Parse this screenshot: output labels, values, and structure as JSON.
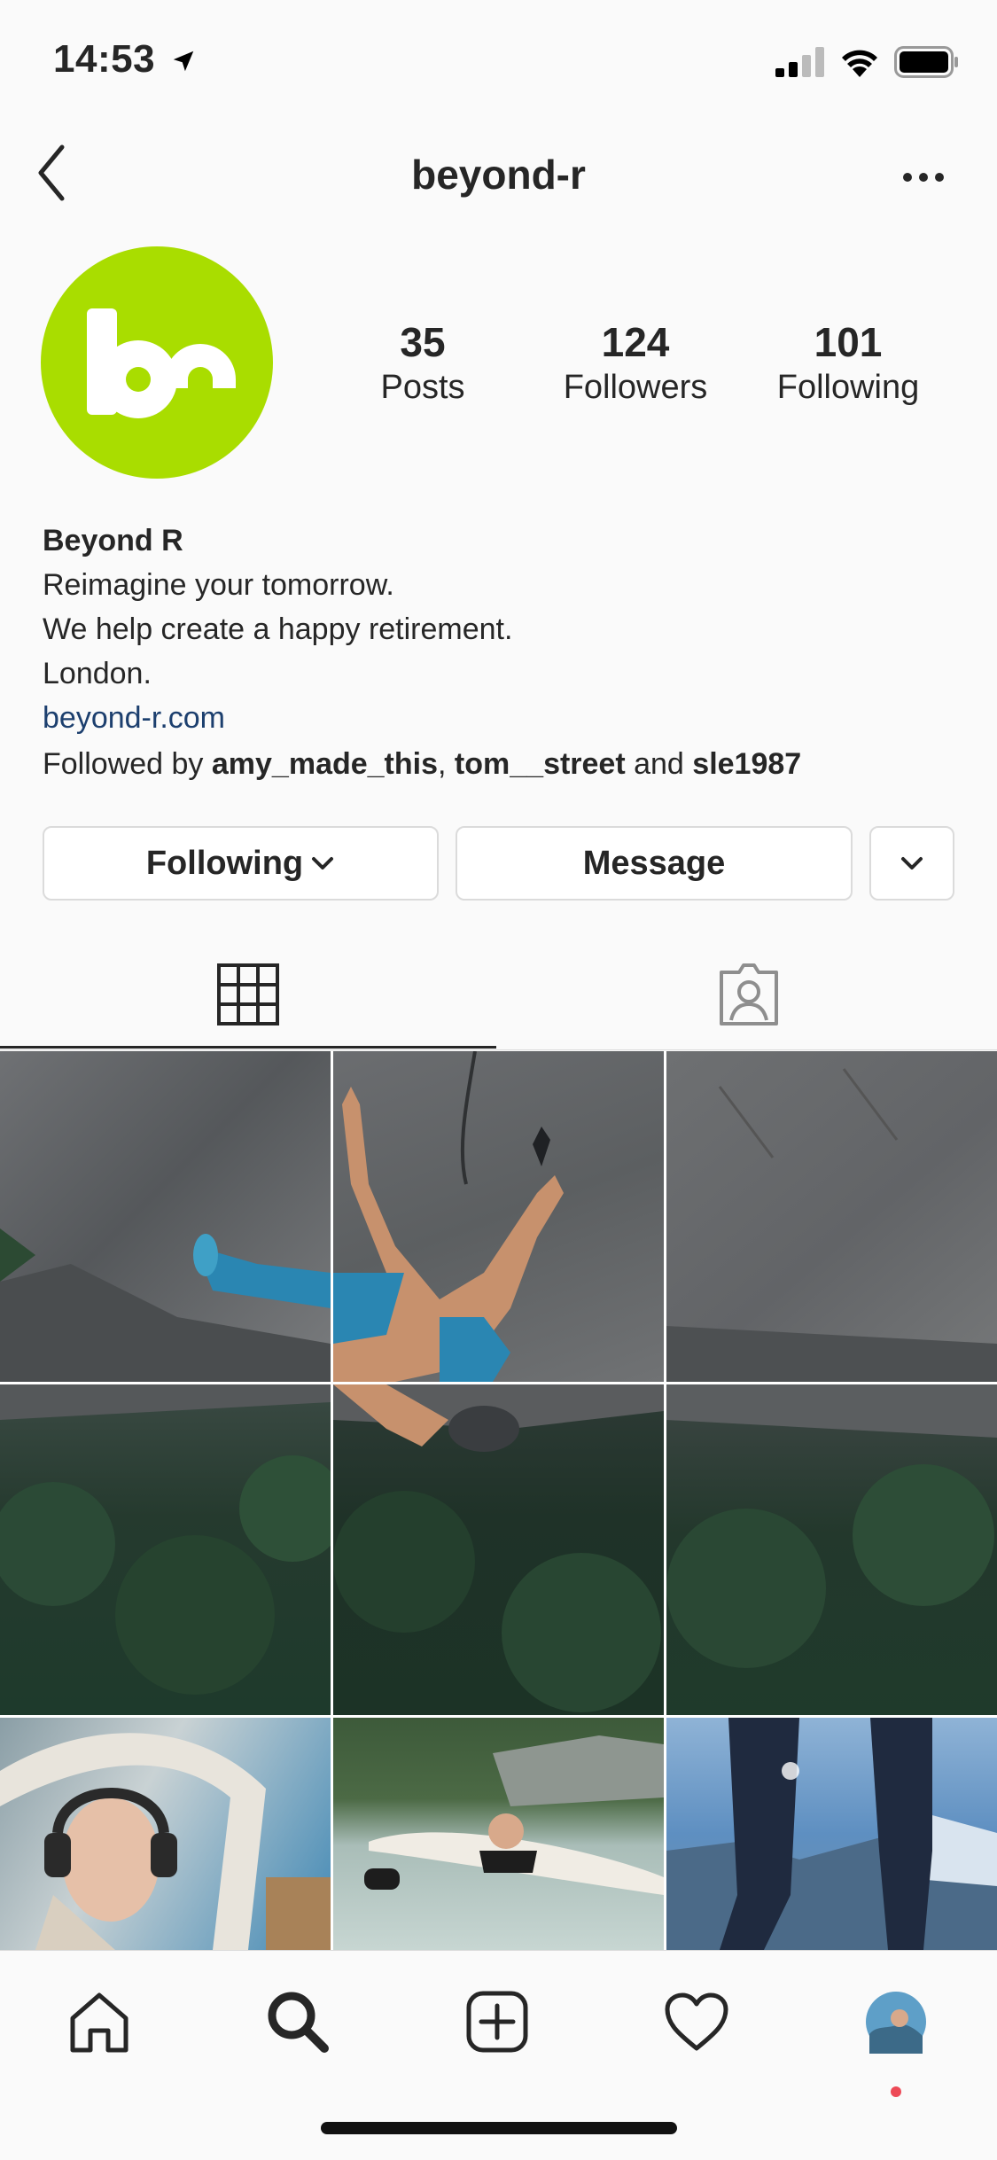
{
  "status_bar": {
    "time": "14:53"
  },
  "header": {
    "username": "beyond-r"
  },
  "profile": {
    "avatar_text": "br",
    "stats": [
      {
        "value": "35",
        "label": "Posts"
      },
      {
        "value": "124",
        "label": "Followers"
      },
      {
        "value": "101",
        "label": "Following"
      }
    ],
    "name": "Beyond R",
    "bio_lines": [
      "Reimagine your tomorrow.",
      "We help create a happy retirement.",
      "London."
    ],
    "link": "beyond-r.com",
    "followed_by": {
      "prefix": "Followed by ",
      "users": [
        "amy_made_this",
        "tom__street",
        "sle1987"
      ],
      "sep": ", ",
      "and": " and "
    }
  },
  "actions": {
    "following_label": "Following",
    "message_label": "Message"
  },
  "tabs": [
    {
      "name": "grid",
      "icon": "grid-icon",
      "active": true
    },
    {
      "name": "tagged",
      "icon": "tagged-person-icon",
      "active": false
    }
  ],
  "colors": {
    "brand": "#a9dd00",
    "link": "#1c3f6e",
    "notification_dot": "#ed4956"
  },
  "grid_posts": [
    {
      "icon": "photo-climber-rock-top-left"
    },
    {
      "icon": "photo-climber-rock-top-center"
    },
    {
      "icon": "photo-climber-rock-top-right"
    },
    {
      "icon": "photo-forest-below-left"
    },
    {
      "icon": "photo-climber-forest-center"
    },
    {
      "icon": "photo-forest-below-right"
    },
    {
      "icon": "photo-pilot-woman"
    },
    {
      "icon": "photo-surfer-man"
    },
    {
      "icon": "photo-legs-mountain-lake"
    }
  ],
  "bottom_nav": [
    {
      "icon": "home-icon"
    },
    {
      "icon": "search-icon"
    },
    {
      "icon": "new-post-icon"
    },
    {
      "icon": "activity-heart-icon"
    },
    {
      "icon": "profile-avatar-icon"
    }
  ]
}
